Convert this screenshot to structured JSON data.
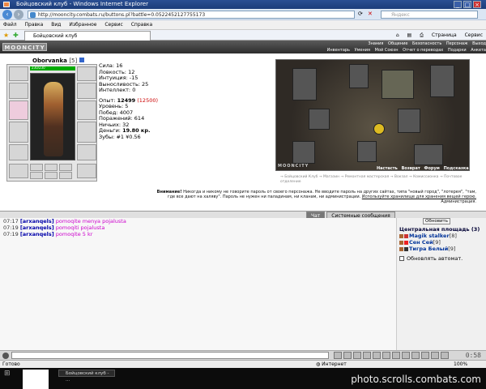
{
  "window": {
    "title": "Бойцовский клуб - Windows Internet Explorer"
  },
  "browser": {
    "address": "http://mooncity.combats.ru/buttons.pl?battle=0.0522452127755173",
    "search_placeholder": "Яндекс",
    "menu": [
      "Файл",
      "Правка",
      "Вид",
      "Избранное",
      "Сервис",
      "Справка"
    ],
    "tab_label": "Бойцовский клуб",
    "tools": [
      "Страница",
      "Сервис"
    ]
  },
  "site": {
    "logo": "MOONCITY",
    "nav_row1": [
      "Знания",
      "Общение",
      "Безопасность",
      "Персонаж",
      "Выход"
    ],
    "nav_row2": [
      "Инвентарь",
      "Умения",
      "Мой Союзн",
      "Отчет о переводах",
      "Подарки",
      "Анкета"
    ]
  },
  "character": {
    "name": "Oborvanka",
    "level": "[5]",
    "hp": "230/230",
    "stats": [
      {
        "label": "Сила:",
        "value": "16"
      },
      {
        "label": "Ловкость:",
        "value": "12"
      },
      {
        "label": "Интуиция:",
        "value": "-15"
      },
      {
        "label": "Выносливость:",
        "value": "25"
      },
      {
        "label": "Интеллект:",
        "value": "0"
      }
    ],
    "exp_label": "Опыт:",
    "exp": "12499",
    "exp_next": "(12500)",
    "level_label": "Уровень:",
    "level_value": "5",
    "wins_label": "Побед:",
    "wins": "4007",
    "losses_label": "Поражений:",
    "losses": "614",
    "draws_label": "Ничьих:",
    "draws": "32",
    "money_label": "Деньги:",
    "money": "19.80 кр.",
    "teeth_label": "Зубы:",
    "teeth": "#1 ¥0.56"
  },
  "map": {
    "label": "MOONCITY",
    "nav": [
      "Настасть",
      "Возврат",
      "Форум",
      "Подсказка"
    ],
    "links": "→ Бойцовский Клуб  → Магазин  → Ремонтная мастерская  → Вокзал  → Комиссионка  → Почтовое отделение"
  },
  "warning": {
    "bold": "Внимание!",
    "text": "Никогда и никому не говорите пароль от своего персонажа. Не вводите пароль на других сайтах, типа \"новый город\", \"лотерея\", \"там, где все дают на халяву\". Пароль не нужен ни паладинам, ни кланам, ни администрации.",
    "link": "Используйте хранилище для хранения вещей герою.",
    "sign": "Администрация."
  },
  "chat": {
    "tabs": [
      "Чат",
      "Системные сообщения"
    ],
    "messages": [
      {
        "time": "07:17",
        "nick": "[arxanqels]",
        "text": "pomoqite menya pojalusta"
      },
      {
        "time": "07:19",
        "nick": "[arxanqels]",
        "text": "pomoqiti pojalusta"
      },
      {
        "time": "07:19",
        "nick": "[arxanqels]",
        "text": "pomoqite 5 kr"
      }
    ]
  },
  "users": {
    "refresh": "Обновить",
    "room": "Центральная площадь (3)",
    "list": [
      {
        "name": "Magik stalker",
        "level": "[8]"
      },
      {
        "name": "Сен Сей",
        "level": "[9]"
      },
      {
        "name": "Тигра Белый",
        "level": "[9]"
      }
    ],
    "auto_update": "Обновлять автомат."
  },
  "clock": "0:58",
  "status": {
    "left": "Готово",
    "zone": "Интернет",
    "zoom": "100%"
  },
  "taskbar": {
    "item": "Бойцовский клуб - ...",
    "watermark": "photo.scrolls.combats.com"
  }
}
